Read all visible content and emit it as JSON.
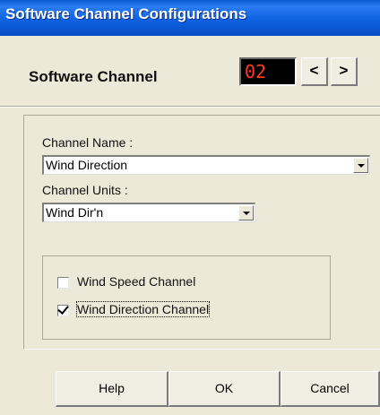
{
  "window": {
    "title": "Software Channel Configurations"
  },
  "header": {
    "channel_label": "Software Channel",
    "channel_number": "02",
    "prev_label": "<",
    "next_label": ">"
  },
  "form": {
    "channel_name_label": "Channel Name :",
    "channel_name_value": "Wind Direction",
    "channel_units_label": "Channel Units :",
    "channel_units_value": "Wind Dir'n",
    "options": [
      {
        "label": "Wind Speed Channel",
        "checked": false
      },
      {
        "label": "Wind Direction Channel",
        "checked": true
      }
    ]
  },
  "buttons": {
    "help": "Help",
    "ok": "OK",
    "cancel": "Cancel"
  },
  "colors": {
    "display_text": "#ff3b1a",
    "display_bg": "#000000",
    "titlebar": "#0c5fe0"
  }
}
